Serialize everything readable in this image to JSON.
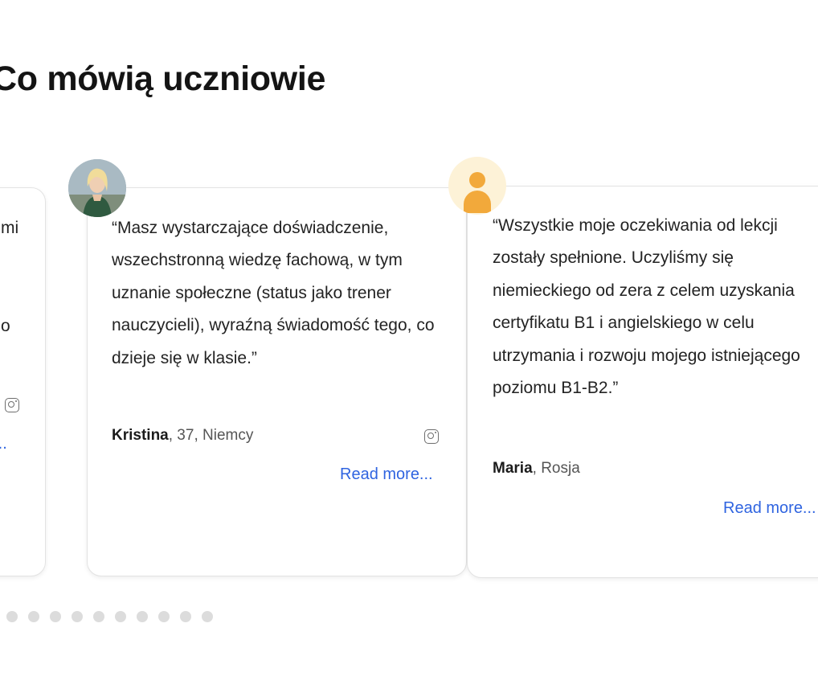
{
  "section": {
    "title": "Co mówią uczniowie"
  },
  "testimonials": [
    {
      "quote_fragments": [
        "mi",
        "o"
      ],
      "read_more": "e..."
    },
    {
      "quote": "“Masz wystarczające doświadczenie, wszechstronną wiedzę fachową, w tym uznanie społeczne (status jako trener nauczycieli), wyraźną świadomość tego, co dzieje się w klasie.”",
      "name": "Kristina",
      "details": ", 37, Niemcy",
      "read_more": "Read more..."
    },
    {
      "quote": "“Wszystkie moje oczekiwania od lekcji zostały spełnione. Uczyliśmy się niemieckiego od zera z celem uzyskania certyfikatu B1 i angielskiego w celu utrzymania i rozwoju mojego istniejącego poziomu B1-B2.”",
      "name": "Maria",
      "details": ", Rosja",
      "read_more": "Read more..."
    }
  ],
  "carousel": {
    "dot_count": 10
  },
  "colors": {
    "link": "#2f64e0",
    "dot": "#dcdcdc",
    "avatar_placeholder_bg": "#fdf2d7",
    "avatar_placeholder_fg": "#f2a93b"
  },
  "icons": {
    "social": "instagram-icon",
    "placeholder_avatar": "user-icon"
  }
}
